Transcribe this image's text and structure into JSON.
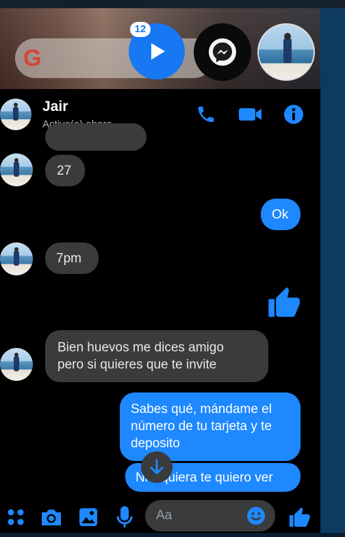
{
  "overlay": {
    "search_logo": "G",
    "badge_count": "12"
  },
  "header": {
    "contact_name": "Jair",
    "status": "Activo(a) ahora"
  },
  "messages": [
    {
      "dir": "received",
      "text": "27"
    },
    {
      "dir": "sent",
      "text": "Ok"
    },
    {
      "dir": "received",
      "text": "7pm"
    },
    {
      "dir": "sent",
      "type": "like"
    },
    {
      "dir": "received",
      "line1": "Bien huevos me dices amigo",
      "line2": "pero si quieres que te invite"
    },
    {
      "dir": "sent",
      "line1": "Sabes qué, mándame el",
      "line2": "número de tu tarjeta y te",
      "line3": "deposito"
    },
    {
      "dir": "sent",
      "text": "Ni siquiera te quiero ver"
    }
  ],
  "composer": {
    "placeholder": "Aa"
  },
  "colors": {
    "accent": "#1e88ff",
    "received_bubble": "#3a3b3c",
    "background": "#000000"
  },
  "icons": [
    "play-icon",
    "messenger-icon",
    "phone-icon",
    "video-camera-icon",
    "info-icon",
    "apps-icon",
    "camera-icon",
    "image-icon",
    "microphone-icon",
    "emoji-icon",
    "thumbs-up-icon",
    "arrow-down-icon"
  ]
}
